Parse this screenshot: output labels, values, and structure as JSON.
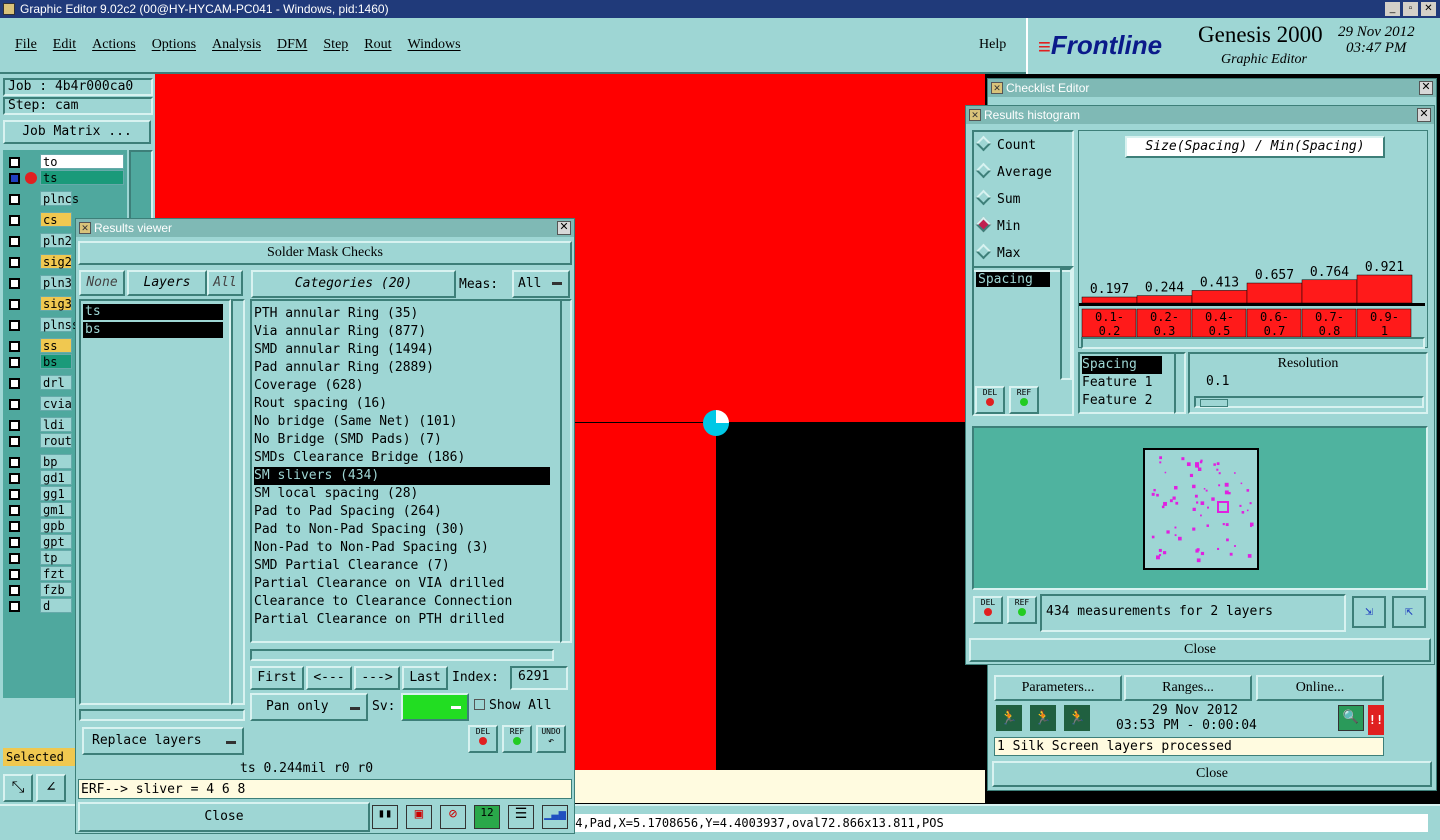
{
  "window_title": "Graphic Editor 9.02c2 (00@HY-HYCAM-PC041 - Windows, pid:1460)",
  "menu": [
    "File",
    "Edit",
    "Actions",
    "Options",
    "Analysis",
    "DFM",
    "Step",
    "Rout",
    "Windows"
  ],
  "help_label": "Help",
  "brand": {
    "logo": "Frontline",
    "product": "Genesis 2000",
    "subtitle": "Graphic Editor",
    "date": "29 Nov 2012",
    "time": "03:47 PM"
  },
  "job": {
    "job_label": "Job : 4b4r000ca0",
    "step_label": "Step: cam",
    "matrix_button": "Job Matrix ..."
  },
  "layers": [
    "to",
    "ts",
    "plncs",
    "cs",
    "pln2",
    "sig2",
    "pln3",
    "sig3",
    "plnss",
    "ss",
    "bs",
    "drl",
    "cvia",
    "ldi",
    "rout",
    "bp",
    "gd1",
    "gg1",
    "gm1",
    "gpb",
    "gpt",
    "tp",
    "fzt",
    "fzb",
    "d"
  ],
  "selected_label": "Selected",
  "status_bar": ",4,Pad,X=5.1708656,Y=4.4003937,oval72.866x13.811,POS",
  "results_viewer": {
    "title": "Results viewer",
    "header": "Solder Mask Checks",
    "none": "None",
    "layers": "Layers",
    "all": "All",
    "categories_button": "Categories (20)",
    "meas_label": "Meas:",
    "meas_value": "All",
    "layer_list": [
      "ts",
      "bs"
    ],
    "categories": [
      "PTH annular Ring (35)",
      "Via annular Ring (877)",
      "SMD annular Ring (1494)",
      "Pad annular Ring (2889)",
      "Coverage (628)",
      "Rout spacing (16)",
      "No bridge (Same Net) (101)",
      "No Bridge (SMD Pads) (7)",
      "SMDs Clearance Bridge (186)",
      "SM slivers (434)",
      "SM local spacing (28)",
      "Pad to Pad Spacing (264)",
      "Pad to Non-Pad Spacing (30)",
      "Non-Pad to Non-Pad Spacing (3)",
      "SMD Partial Clearance (7)",
      "Partial Clearance on VIA drilled",
      "Clearance to Clearance Connection",
      "Partial Clearance on PTH drilled"
    ],
    "selected_category": "SM slivers (434)",
    "nav": {
      "first": "First",
      "prev": "<---",
      "next": "--->",
      "last": "Last",
      "index_label": "Index:",
      "index_value": "6291"
    },
    "pan_only": "Pan only",
    "sv_label": "Sv:",
    "show_all": "Show All",
    "replace_layers": "Replace layers",
    "del": "DEL",
    "ref": "REF",
    "undo": "UNDO",
    "info": "ts 0.244mil  r0  r0",
    "erf": "ERF--> sliver = 4 6 8",
    "close": "Close"
  },
  "checklist_editor": {
    "title": "Checklist Editor",
    "parameters": "Parameters...",
    "ranges": "Ranges...",
    "online": "Online...",
    "date": "29 Nov 2012",
    "time": "03:53 PM - 0:00:04",
    "message": "1 Silk Screen layers processed",
    "close": "Close"
  },
  "histogram": {
    "title": "Results histogram",
    "options": [
      "Count",
      "Average",
      "Sum",
      "Min",
      "Max"
    ],
    "selected_option": "Min",
    "header": "Size(Spacing) / Min(Spacing)",
    "list_item": "Spacing",
    "chart_data": {
      "type": "bar",
      "categories": [
        "0.1-0.2",
        "0.2-0.3",
        "0.4-0.5",
        "0.6-0.7",
        "0.7-0.8",
        "0.9-1"
      ],
      "values": [
        0.197,
        0.244,
        0.413,
        0.657,
        0.764,
        0.921
      ],
      "color": "#ff1a1a"
    },
    "attr_list": [
      "Spacing",
      "Feature 1",
      "Feature 2"
    ],
    "resolution_label": "Resolution",
    "resolution_value": "0.1",
    "measurements": "434 measurements for 2 layers",
    "del": "DEL",
    "ref": "REF",
    "close": "Close"
  },
  "colors": {
    "red": "#ff0000",
    "teal": "#9ed6d4",
    "title_blue": "#203a7a"
  }
}
